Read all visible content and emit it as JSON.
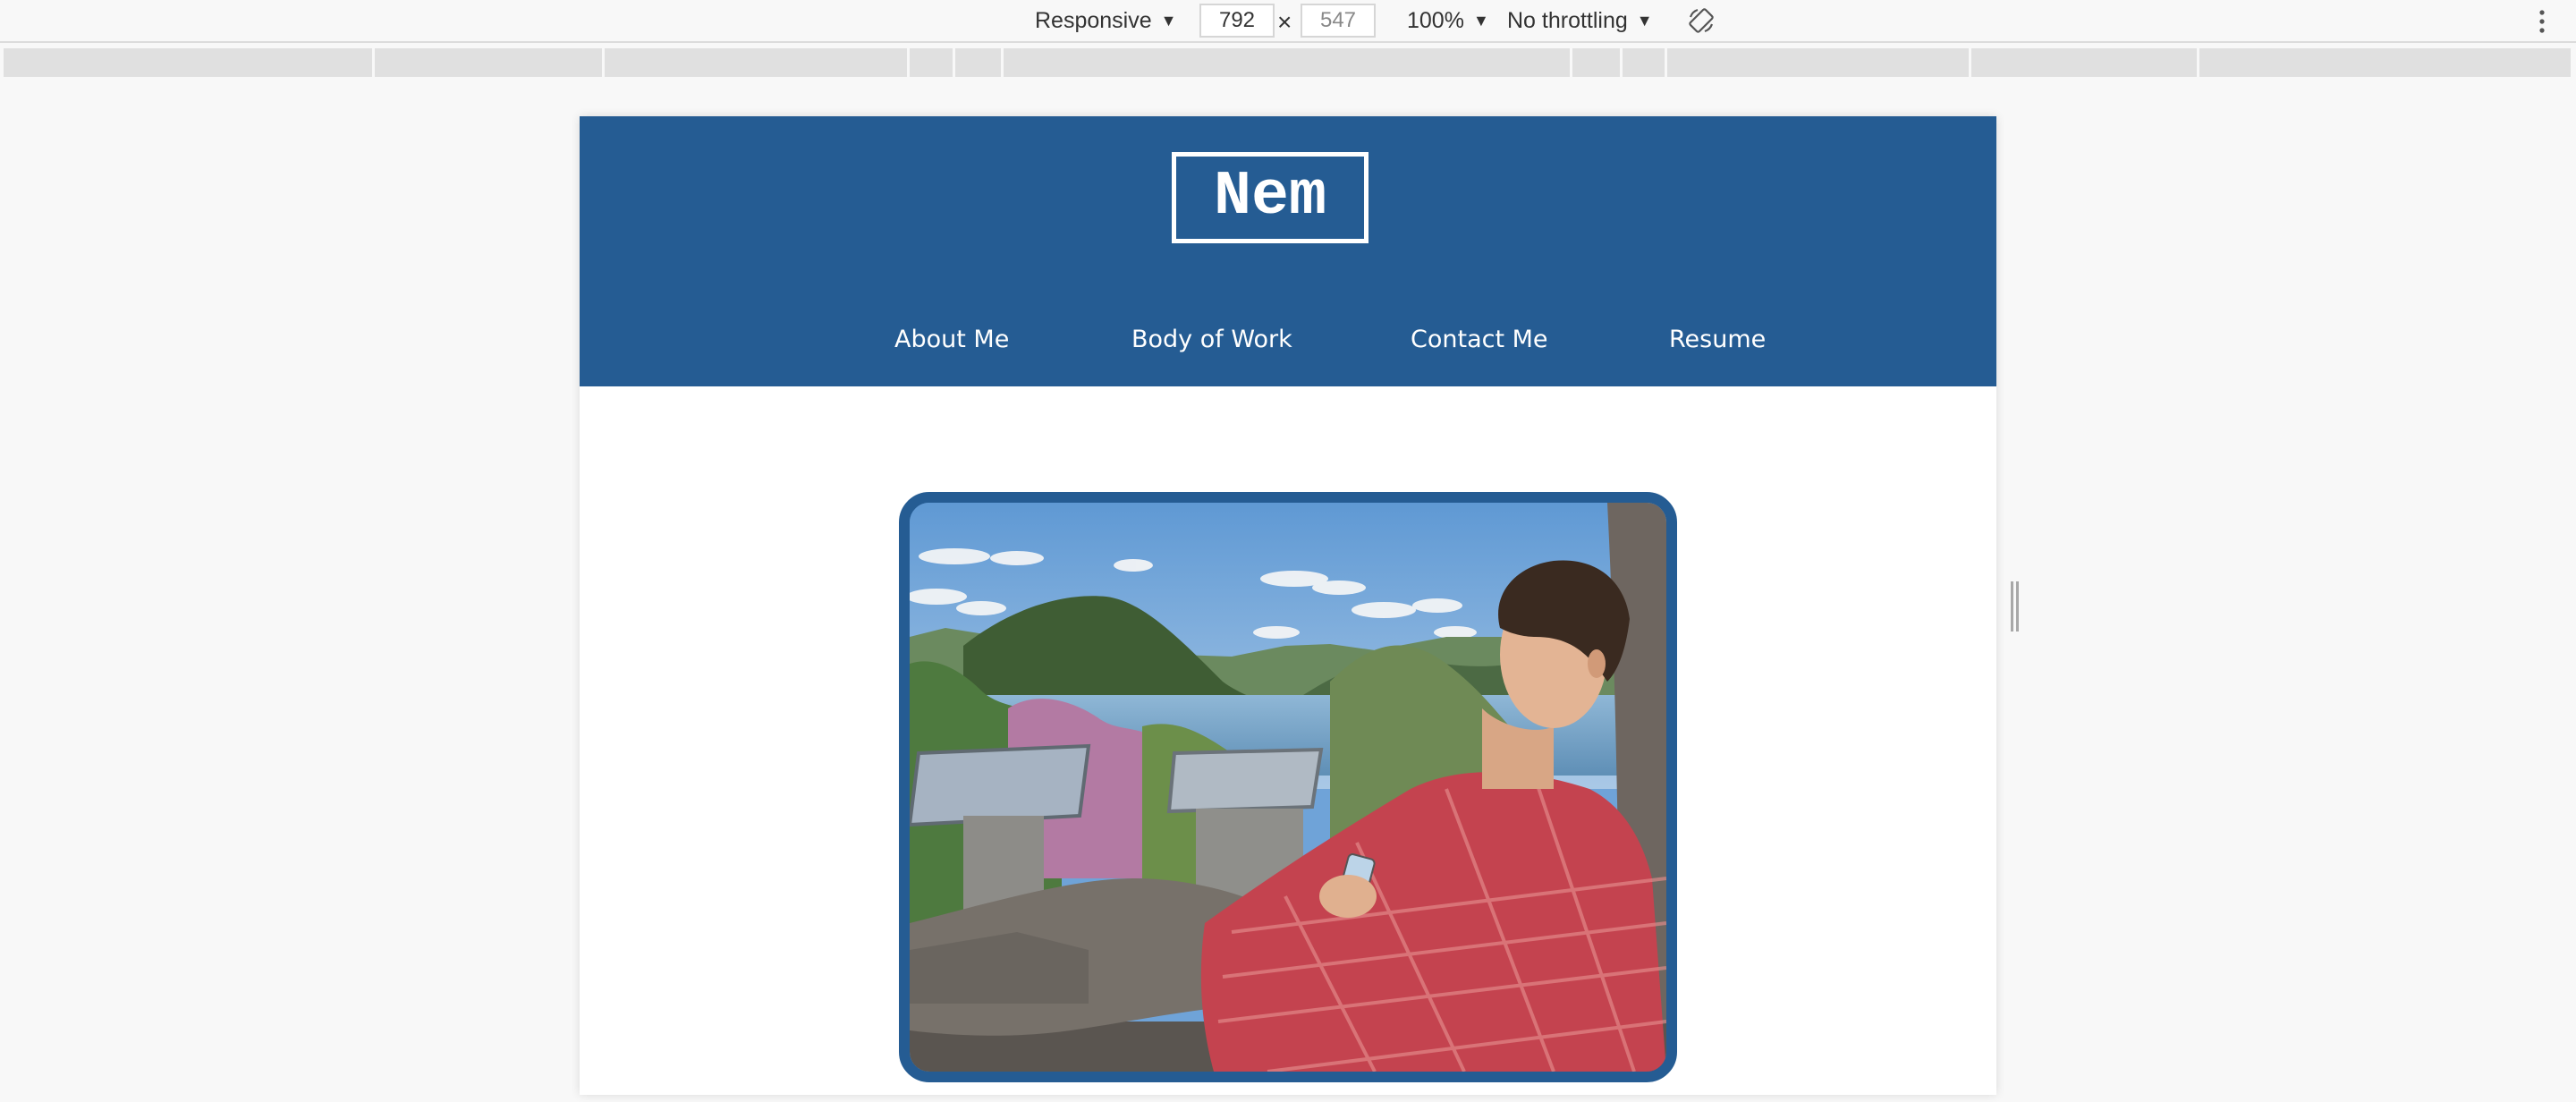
{
  "devtools": {
    "device_mode": "Responsive",
    "width_value": "792",
    "height_value": "547",
    "dimension_separator": "×",
    "zoom": "100%",
    "throttling": "No throttling"
  },
  "site": {
    "logo_text": "Nem",
    "nav": [
      {
        "label": "About Me"
      },
      {
        "label": "Body of Work"
      },
      {
        "label": "Contact Me"
      },
      {
        "label": "Resume"
      }
    ],
    "colors": {
      "header_bg": "#255c93",
      "nav_text": "#ffffff",
      "frame_border": "#255c93"
    }
  },
  "icons": {
    "rotate": "rotate-icon",
    "more": "kebab-menu-icon",
    "dropdown": "caret-down-icon"
  }
}
